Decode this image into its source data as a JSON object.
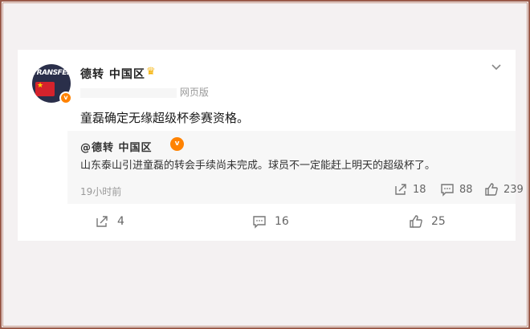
{
  "post": {
    "author": "德转 中国区",
    "source": "网页版",
    "text": "童磊确定无缘超级杯参赛资格。",
    "avatar_text": "TRANSFER",
    "verified_mark": "v"
  },
  "quote": {
    "author": "@德转 中国区",
    "verified_mark": "v",
    "text": "山东泰山引进童磊的转会手续尚未完成。球员不一定能赶上明天的超级杯了。",
    "time": "19小时前",
    "reposts": "18",
    "comments": "88",
    "likes": "239"
  },
  "footer": {
    "reposts": "4",
    "comments": "16",
    "likes": "25"
  },
  "colors": {
    "accent_orange": "#ff8200",
    "frame_brown": "#9a5a4a"
  },
  "icons": {
    "menu": "chevron-down-icon",
    "repost": "share-icon",
    "comment": "comment-icon",
    "like": "thumbs-up-icon"
  }
}
